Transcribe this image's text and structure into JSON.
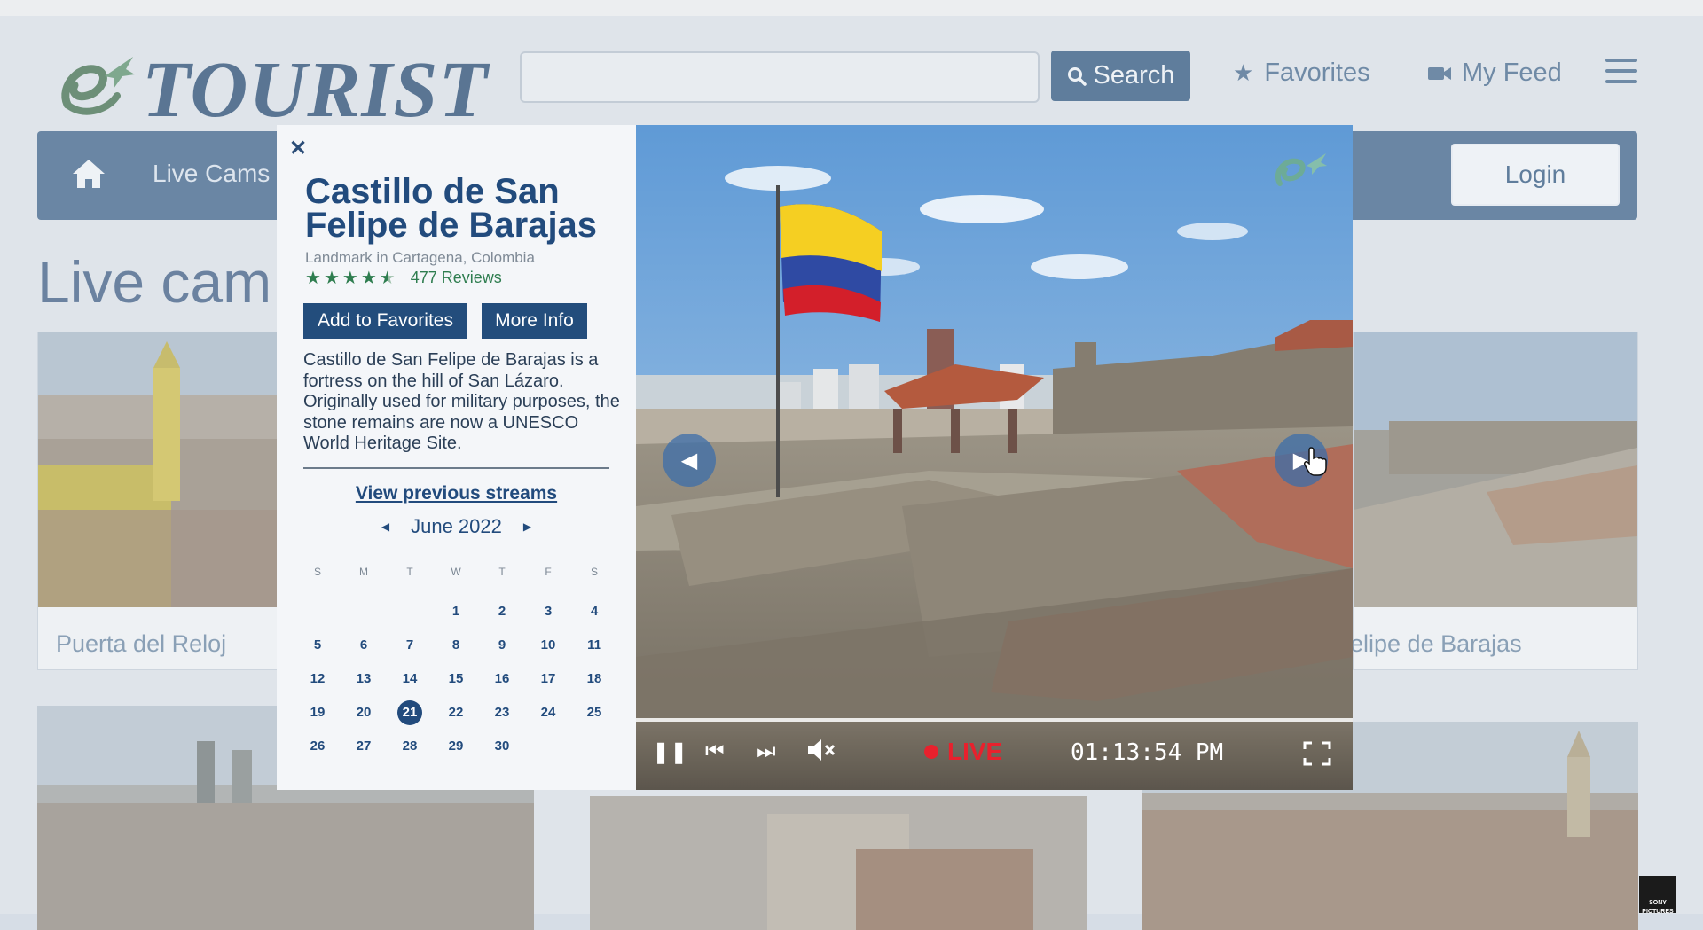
{
  "site": {
    "logo_text": "TOURIST",
    "search_button": "Search",
    "favorites_link": "Favorites",
    "feed_link": "My Feed",
    "nav_live": "Live Cams",
    "login_button": "Login",
    "page_heading": "Live cam"
  },
  "cards": [
    {
      "label": "Puerta del Reloj"
    },
    {
      "label": "elipe de Barajas"
    }
  ],
  "popup": {
    "close_icon": "close-icon",
    "title": "Castillo de San Felipe de Barajas",
    "subtitle": "Landmark in Cartagena, Colombia",
    "rating": 4.5,
    "reviews": "477 Reviews",
    "add_favorites": "Add to Favorites",
    "more_info": "More Info",
    "description": "Castillo de San Felipe de Barajas is a fortress on the hill of San Lázaro. Originally used for military purposes, the stone remains are now a UNESCO World Heritage Site.",
    "prev_streams": "View previous streams",
    "month": "June 2022",
    "weekdays": [
      "S",
      "M",
      "T",
      "W",
      "T",
      "F",
      "S"
    ],
    "weeks": [
      [
        "",
        "",
        "",
        "1",
        "2",
        "3",
        "4"
      ],
      [
        "5",
        "6",
        "7",
        "8",
        "9",
        "10",
        "11"
      ],
      [
        "12",
        "13",
        "14",
        "15",
        "16",
        "17",
        "18"
      ],
      [
        "19",
        "20",
        "21",
        "22",
        "23",
        "24",
        "25"
      ],
      [
        "26",
        "27",
        "28",
        "29",
        "30",
        "",
        ""
      ]
    ],
    "selected_day": "21"
  },
  "player": {
    "live_label": "LIVE",
    "time": "01:13:54 PM",
    "colors": {
      "live": "#e8212d",
      "brand": "#224b7d"
    }
  },
  "corner_badge": "SONY PICTURES"
}
